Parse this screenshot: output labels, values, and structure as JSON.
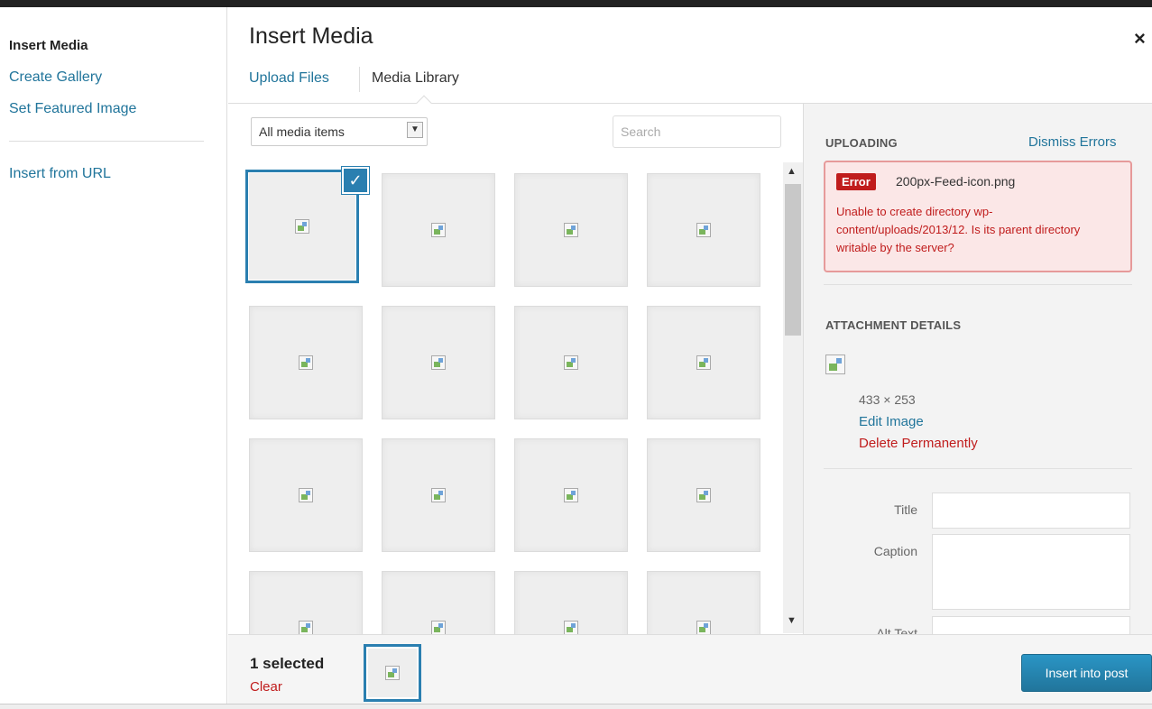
{
  "menu": {
    "items": [
      {
        "label": "Insert Media"
      },
      {
        "label": "Create Gallery"
      },
      {
        "label": "Set Featured Image"
      },
      {
        "label": "Insert from URL"
      }
    ]
  },
  "header": {
    "title": "Insert Media",
    "close_glyph": "×",
    "tabs": [
      {
        "label": "Upload Files"
      },
      {
        "label": "Media Library"
      }
    ]
  },
  "toolbar": {
    "filter_value": "All media items",
    "filter_arrow_glyph": "▼",
    "search_placeholder": "Search"
  },
  "grid": {
    "selected_check_glyph": "✓",
    "scroll_up_glyph": "▲",
    "scroll_down_glyph": "▼"
  },
  "sidebar": {
    "uploading_heading": "UPLOADING",
    "dismiss_label": "Dismiss Errors",
    "error": {
      "badge": "Error",
      "filename": "200px-Feed-icon.png",
      "message": "Unable to create directory wp-content/uploads/2013/12. Is its parent directory writable by the server?"
    },
    "attachment_heading": "ATTACHMENT DETAILS",
    "dimensions": "433 × 253",
    "edit_label": "Edit Image",
    "delete_label": "Delete Permanently",
    "fields": [
      {
        "label": "Title"
      },
      {
        "label": "Caption"
      },
      {
        "label": "Alt Text"
      }
    ]
  },
  "footer": {
    "selected_count": "1 selected",
    "clear_label": "Clear",
    "insert_button": "Insert into post"
  },
  "colors": {
    "link": "#21759b",
    "error": "#c01c1c",
    "selected_border": "#2a7fb0",
    "primary_button": "#21759b"
  }
}
